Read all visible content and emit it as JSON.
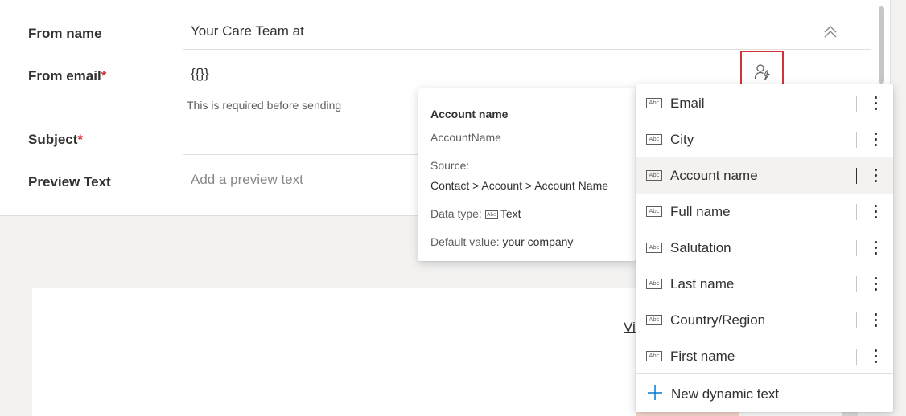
{
  "form": {
    "from_name_label": "From name",
    "from_name_value": "Your Care Team at",
    "from_email_label": "From email",
    "from_email_value": "{{}}",
    "from_email_helper": "This is required before sending",
    "subject_label": "Subject",
    "preview_text_label": "Preview Text",
    "preview_text_placeholder": "Add a preview text",
    "required_marker": "*"
  },
  "canvas": {
    "link_text": "Vi"
  },
  "tooltip": {
    "title": "Account name",
    "subtitle": "AccountName",
    "source_label": "Source:",
    "source_path": "Contact > Account > Account Name",
    "data_type_label": "Data type:",
    "data_type_value": "Text",
    "default_value_label": "Default value:",
    "default_value_value": "your company"
  },
  "dropdown": {
    "icon_text": "Abc",
    "items": [
      {
        "label": "Email"
      },
      {
        "label": "City"
      },
      {
        "label": "Account name"
      },
      {
        "label": "Full name"
      },
      {
        "label": "Salutation"
      },
      {
        "label": "Last name"
      },
      {
        "label": "Country/Region"
      },
      {
        "label": "First name"
      }
    ],
    "selected_index": 2,
    "footer_label": "New dynamic text"
  },
  "icons": {
    "personalize": "person-lightning-icon",
    "collapse": "double-chevron-up-icon",
    "text_type": "abc-text-icon",
    "more": "more-vertical-icon",
    "add": "plus-icon"
  },
  "colors": {
    "required": "#d13438",
    "highlight_border": "#d13438",
    "accent_blue": "#0078d4"
  }
}
